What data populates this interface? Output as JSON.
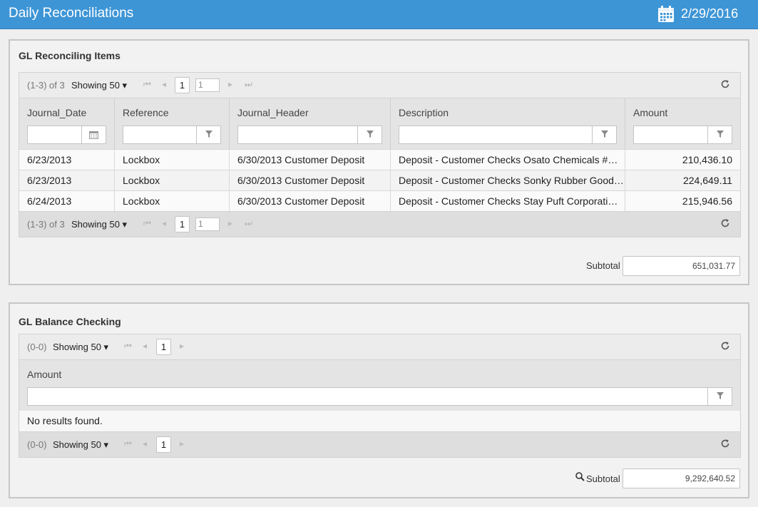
{
  "header": {
    "title": "Daily Reconciliations",
    "date": "2/29/2016",
    "calendar_icon": "calendar-icon"
  },
  "colors": {
    "header_bg": "#3d95d6",
    "panel_bg": "#f2f2f2"
  },
  "reconciling": {
    "title": "GL Reconciling Items",
    "pager_top": {
      "range": "(1-3) of 3",
      "showing": "Showing 50 ▾",
      "page": "1",
      "page_input": "1"
    },
    "pager_bottom": {
      "range": "(1-3) of 3",
      "showing": "Showing 50 ▾",
      "page": "1",
      "page_input": "1"
    },
    "columns": [
      "Journal_Date",
      "Reference",
      "Journal_Header",
      "Description",
      "Amount"
    ],
    "rows": [
      [
        "6/23/2013",
        "Lockbox",
        "6/30/2013 Customer Deposit",
        "Deposit - Customer Checks Osato Chemicals #…",
        "210,436.10"
      ],
      [
        "6/23/2013",
        "Lockbox",
        "6/30/2013 Customer Deposit",
        "Deposit - Customer Checks Sonky Rubber Good…",
        "224,649.11"
      ],
      [
        "6/24/2013",
        "Lockbox",
        "6/30/2013 Customer Deposit",
        "Deposit - Customer Checks Stay Puft Corporati…",
        "215,946.56"
      ]
    ],
    "subtotal_label": "Subtotal",
    "subtotal_value": "651,031.77"
  },
  "balance": {
    "title": "GL Balance Checking",
    "pager_top": {
      "range": "(0-0)",
      "showing": "Showing 50 ▾",
      "page": "1"
    },
    "pager_bottom": {
      "range": "(0-0)",
      "showing": "Showing 50 ▾",
      "page": "1"
    },
    "column": "Amount",
    "no_results": "No results found.",
    "subtotal_label": "Subtotal",
    "subtotal_value": "9,292,640.52"
  }
}
